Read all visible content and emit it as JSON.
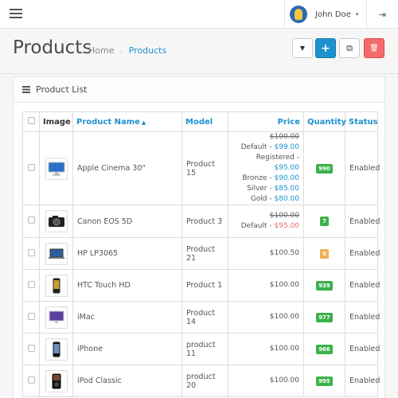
{
  "topbar": {
    "user_name": "John Doe",
    "caret": "▾",
    "logout_glyph": "⇥"
  },
  "header": {
    "title": "Products",
    "breadcrumb_home": "Home",
    "breadcrumb_sep": "›",
    "breadcrumb_current": "Products"
  },
  "toolbar": {
    "filter_glyph": "▼",
    "add_glyph": "+",
    "copy_glyph": "⧉",
    "delete_glyph": "🗑"
  },
  "panel": {
    "title": "Product List"
  },
  "table": {
    "headers": {
      "image": "Image",
      "name": "Product Name",
      "name_sort": "▲",
      "model": "Model",
      "price": "Price",
      "quantity": "Quantity",
      "status": "Status"
    },
    "rows": [
      {
        "name": "Apple Cinema 30\"",
        "model": "Product 15",
        "old_price": "$100.00",
        "price": "",
        "specials": [
          {
            "group": "Default",
            "price": "$99.00"
          },
          {
            "group": "Registered",
            "price": "$95.00"
          },
          {
            "group": "Bronze",
            "price": "$90.00"
          },
          {
            "group": "Silver",
            "price": "$85.00"
          },
          {
            "group": "Gold",
            "price": "$80.00"
          }
        ],
        "quantity": "990",
        "qty_level": "ok",
        "status": "Enabled",
        "icon": "monitor-icon"
      },
      {
        "name": "Canon EOS 5D",
        "model": "Product 3",
        "old_price": "$100.00",
        "price": "",
        "specials": [
          {
            "group": "Default",
            "price": "$95.00",
            "red": true
          }
        ],
        "quantity": "7",
        "qty_level": "ok",
        "status": "Enabled",
        "icon": "camera-icon"
      },
      {
        "name": "HP LP3065",
        "model": "Product 21",
        "old_price": "",
        "price": "$100.50",
        "specials": [],
        "quantity": "0",
        "qty_level": "warn",
        "status": "Enabled",
        "icon": "laptop-icon"
      },
      {
        "name": "HTC Touch HD",
        "model": "Product 1",
        "old_price": "",
        "price": "$100.00",
        "specials": [],
        "quantity": "939",
        "qty_level": "ok",
        "status": "Enabled",
        "icon": "phone-icon"
      },
      {
        "name": "iMac",
        "model": "Product 14",
        "old_price": "",
        "price": "$100.00",
        "specials": [],
        "quantity": "977",
        "qty_level": "ok",
        "status": "Enabled",
        "icon": "imac-icon"
      },
      {
        "name": "iPhone",
        "model": "product 11",
        "old_price": "",
        "price": "$100.00",
        "specials": [],
        "quantity": "966",
        "qty_level": "ok",
        "status": "Enabled",
        "icon": "iphone-icon"
      },
      {
        "name": "iPod Classic",
        "model": "product 20",
        "old_price": "",
        "price": "$100.00",
        "specials": [],
        "quantity": "995",
        "qty_level": "ok",
        "status": "Enabled",
        "icon": "ipod-icon"
      }
    ]
  },
  "colors": {
    "accent": "#1e91cf",
    "success": "#3bb14a",
    "warning": "#f0ad4e",
    "danger": "#f56b6b"
  }
}
